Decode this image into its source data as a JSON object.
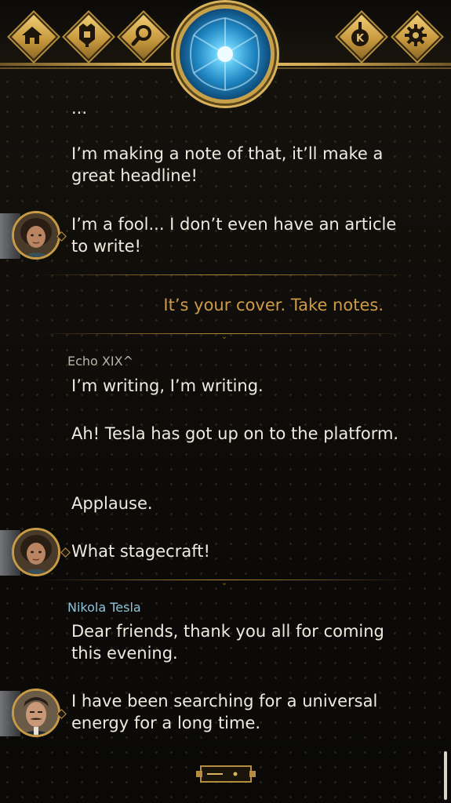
{
  "nav": {
    "left_buttons": [
      {
        "name": "home",
        "icon": "home-icon"
      },
      {
        "name": "inventory",
        "icon": "character-icon"
      },
      {
        "name": "search",
        "icon": "magnifier-icon"
      }
    ],
    "right_buttons": [
      {
        "name": "keys",
        "icon": "k-token-icon",
        "label": "K"
      },
      {
        "name": "settings",
        "icon": "gear-icon"
      }
    ],
    "center_icon": "aperture-eye-icon"
  },
  "colors": {
    "accent_gold": "#cf9a46",
    "speaker_echo": "#b9b3a8",
    "speaker_tesla": "#8ec4da",
    "text": "#efeae0"
  },
  "chat": {
    "ellipsis": "...",
    "msg_note": "I’m making a note of that, it’ll make a great headline!",
    "msg_fool": "I’m a fool... I don’t even have an article to write!",
    "reply_cover": "It’s your cover. Take notes.",
    "speaker_echo": "Echo XIX^",
    "msg_writing": "I’m writing, I’m writing.",
    "msg_platform": "Ah! Tesla has got up on to the platform.",
    "msg_applause": "Applause.",
    "msg_stagecraft": "What stagecraft!",
    "speaker_tesla": "Nikola Tesla",
    "msg_friends": "Dear friends, thank you all for coming this evening.",
    "msg_energy": "I have been searching for a universal energy for a long time."
  }
}
